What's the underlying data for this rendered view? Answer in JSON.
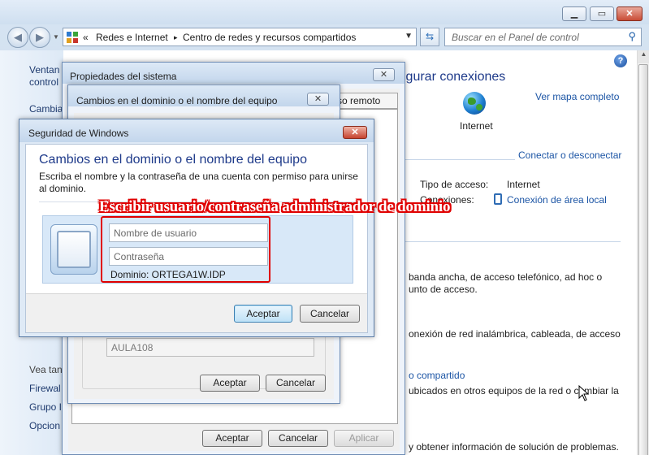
{
  "control_panel": {
    "breadcrumb_prefix": "«",
    "breadcrumb_1": "Redes e Internet",
    "breadcrumb_sep": "▸",
    "breadcrumb_2": "Centro de redes y recursos compartidos",
    "search_placeholder": "Buscar en el Panel de control",
    "sidebar": {
      "item_1a": "Ventan",
      "item_1b": "control",
      "item_2": "Cambia",
      "see_also": "Vea tan",
      "item_3": "Firewal",
      "item_4": "Grupo I",
      "item_5": "Opcion"
    },
    "heading_partial": "igurar conexiones",
    "map_link": "Ver mapa completo",
    "internet_label": "Internet",
    "connect_link": "Conectar o desconectar",
    "access_type_label": "Tipo de acceso:",
    "access_type_value": "Internet",
    "connections_label": "Conexiones:",
    "connection_link": "Conexión de área local",
    "text_1a": "banda ancha, de acceso telefónico, ad hoc o",
    "text_1b": "unto de acceso.",
    "text_2": "onexión de red inalámbrica, cableada, de acceso",
    "text_3_link": "o compartido",
    "text_3b": "ubicados en otros equipos de la red o cambiar la",
    "text_4": "y obtener información de solución de problemas."
  },
  "properties_dialog": {
    "title": "Propiedades del sistema",
    "tab_partial": "so remoto",
    "ok": "Aceptar",
    "cancel": "Cancelar",
    "apply": "Aplicar"
  },
  "domain_dialog": {
    "title": "Cambios en el dominio o el nombre del equipo",
    "workgroup_value": "AULA108",
    "ok": "Aceptar",
    "cancel": "Cancelar"
  },
  "security_dialog": {
    "title": "Seguridad de Windows",
    "heading": "Cambios en el dominio o el nombre del equipo",
    "desc_1": "Escriba el nombre y la contraseña de una cuenta con permiso para unirse",
    "desc_2": "al dominio.",
    "username_placeholder": "Nombre de usuario",
    "password_placeholder": "Contraseña",
    "domain_label": "Dominio: ORTEGA1W.IDP",
    "ok": "Aceptar",
    "cancel": "Cancelar"
  },
  "annotation": {
    "text": "Escribir usuario/contraseña administrador de dominio",
    "color": "#e00000"
  },
  "icons": [
    "minimize-icon",
    "maximize-icon",
    "close-icon",
    "back-icon",
    "forward-icon",
    "network-icon",
    "refresh-icon",
    "search-icon",
    "help-icon",
    "globe-icon",
    "lan-connection-icon",
    "user-tile-icon",
    "mouse-cursor-icon"
  ]
}
